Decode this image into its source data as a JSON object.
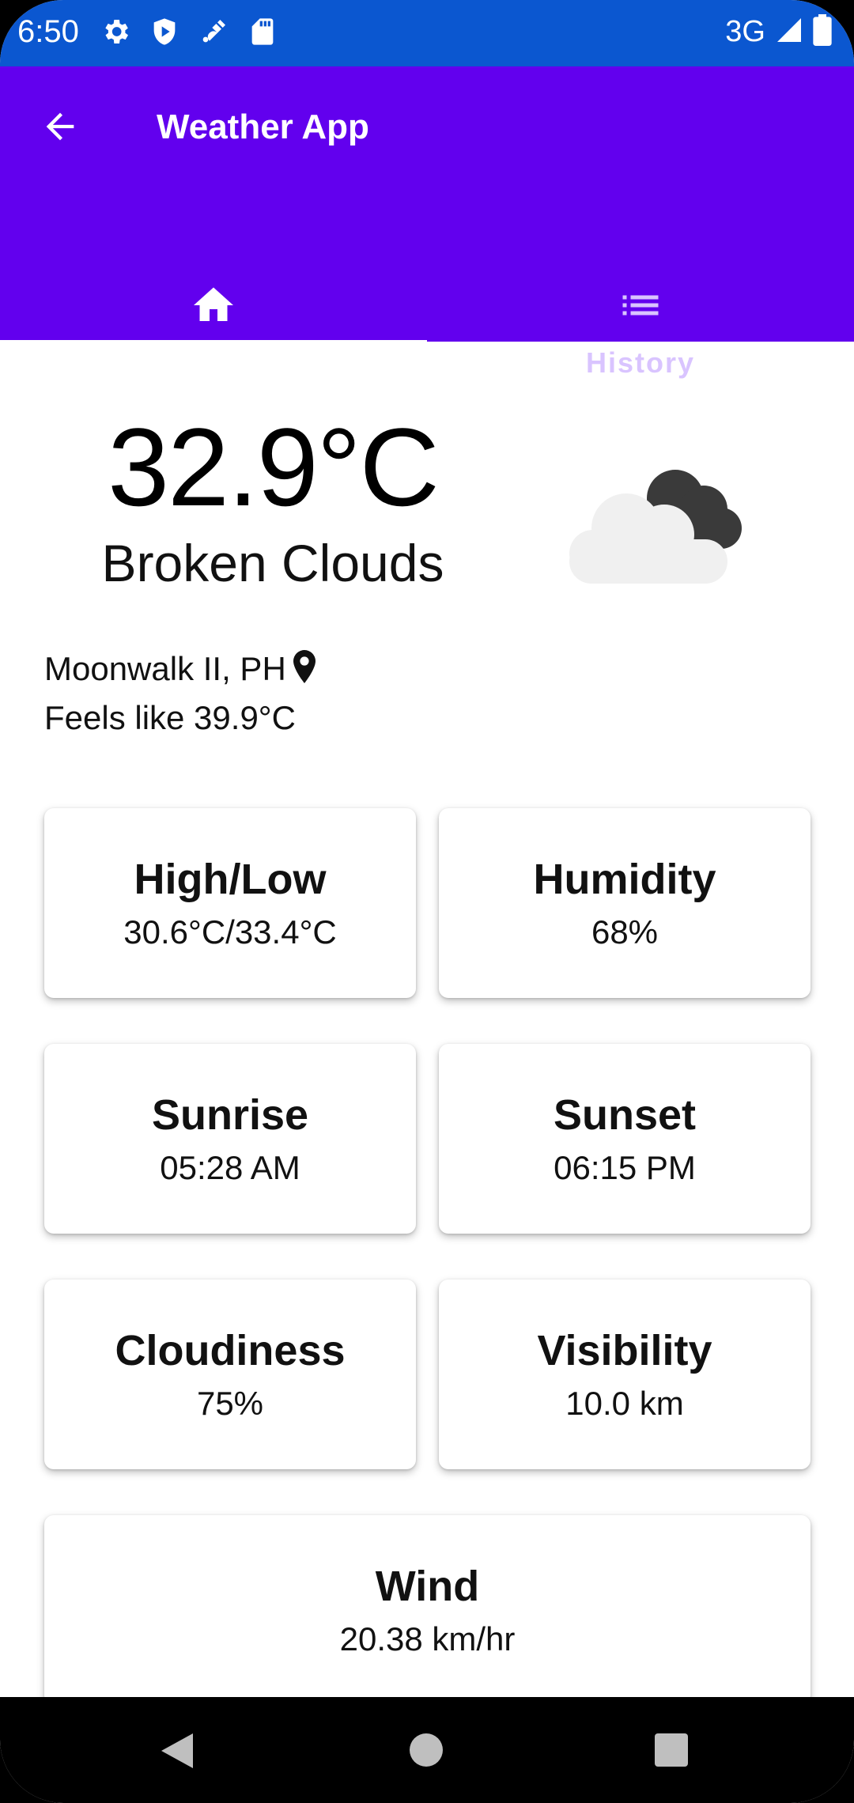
{
  "status_bar": {
    "time": "6:50",
    "network": "3G",
    "left_icons": [
      "settings-icon",
      "shield-play-icon",
      "satellite-icon",
      "sd-card-icon"
    ]
  },
  "app_bar": {
    "title": "Weather App",
    "back_icon": "arrow-back-icon",
    "color": "#6200ee"
  },
  "tabs": [
    {
      "label": "Home",
      "icon": "home-icon",
      "active": true
    },
    {
      "label": "History",
      "icon": "list-icon",
      "active": false
    }
  ],
  "current": {
    "temperature": "32.9°C",
    "condition": "Broken Clouds",
    "location": "Moonwalk II, PH",
    "feels_like": "Feels like 39.9°C",
    "icon": "broken-clouds-icon"
  },
  "cards": {
    "high_low": {
      "title": "High/Low",
      "value": "30.6°C/33.4°C"
    },
    "humidity": {
      "title": "Humidity",
      "value": "68%"
    },
    "sunrise": {
      "title": "Sunrise",
      "value": "05:28 AM"
    },
    "sunset": {
      "title": "Sunset",
      "value": "06:15 PM"
    },
    "cloudiness": {
      "title": "Cloudiness",
      "value": "75%"
    },
    "visibility": {
      "title": "Visibility",
      "value": "10.0 km"
    },
    "wind": {
      "title": "Wind",
      "value": "20.38 km/hr"
    }
  },
  "colors": {
    "status_bar": "#0b57d0",
    "primary": "#6200ee",
    "tab_inactive": "#d9c4ff"
  }
}
